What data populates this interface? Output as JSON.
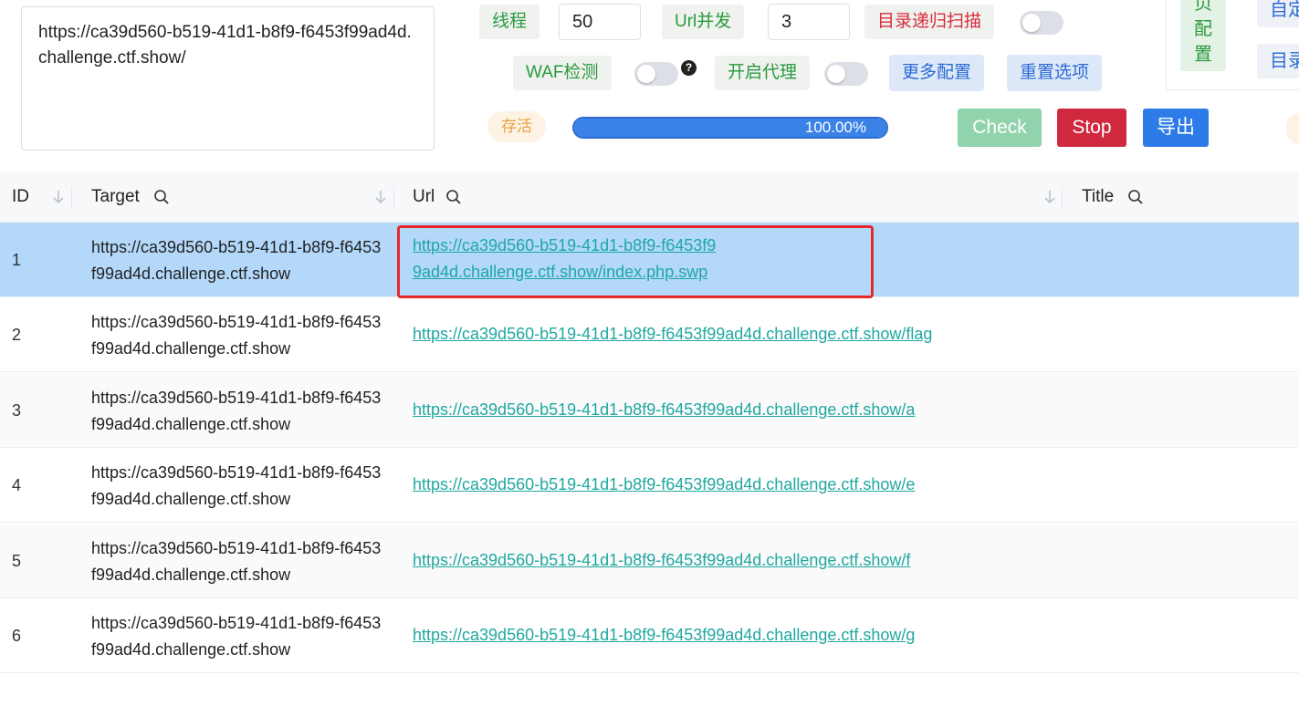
{
  "target_input": {
    "value": "https://ca39d560-b519-41d1-b8f9-f6453f99ad4d.challenge.ctf.show/"
  },
  "controls": {
    "threads_label": "线程",
    "threads_value": "50",
    "url_concurrency_label": "Url并发",
    "url_concurrency_value": "3",
    "recursive_scan_label": "目录递归扫描",
    "waf_detect_label": "WAF检测",
    "help_glyph": "?",
    "proxy_label": "开启代理",
    "more_config_label": "更多配置",
    "reset_options_label": "重置选项",
    "alive_label": "存活",
    "progress_text": "100.00%",
    "progress_value": 1.0,
    "check_label": "Check",
    "stop_label": "Stop",
    "export_label": "导出"
  },
  "right_panel": {
    "config_chars": [
      "页",
      "配",
      "置"
    ],
    "item1": "自定",
    "item2": "目录"
  },
  "colors": {
    "selected_row": "#b3d8fa",
    "link": "#1fa8a0",
    "highlight": "#e5282a",
    "stop": "#d0283e",
    "check": "#90d3ac",
    "export": "#2d7be8"
  },
  "table": {
    "headers": {
      "id": "ID",
      "target": "Target",
      "url": "Url",
      "title": "Title"
    },
    "rows": [
      {
        "id": "1",
        "target": "https://ca39d560-b519-41d1-b8f9-f6453f99ad4d.challenge.ctf.show",
        "url": "https://ca39d560-b519-41d1-b8f9-f6453f99ad4d.challenge.ctf.show/index.php.swp",
        "title": ""
      },
      {
        "id": "2",
        "target": "https://ca39d560-b519-41d1-b8f9-f6453f99ad4d.challenge.ctf.show",
        "url": "https://ca39d560-b519-41d1-b8f9-f6453f99ad4d.challenge.ctf.show/flag",
        "title": ""
      },
      {
        "id": "3",
        "target": "https://ca39d560-b519-41d1-b8f9-f6453f99ad4d.challenge.ctf.show",
        "url": "https://ca39d560-b519-41d1-b8f9-f6453f99ad4d.challenge.ctf.show/a",
        "title": ""
      },
      {
        "id": "4",
        "target": "https://ca39d560-b519-41d1-b8f9-f6453f99ad4d.challenge.ctf.show",
        "url": "https://ca39d560-b519-41d1-b8f9-f6453f99ad4d.challenge.ctf.show/e",
        "title": ""
      },
      {
        "id": "5",
        "target": "https://ca39d560-b519-41d1-b8f9-f6453f99ad4d.challenge.ctf.show",
        "url": "https://ca39d560-b519-41d1-b8f9-f6453f99ad4d.challenge.ctf.show/f",
        "title": ""
      },
      {
        "id": "6",
        "target": "https://ca39d560-b519-41d1-b8f9-f6453f99ad4d.challenge.ctf.show",
        "url": "https://ca39d560-b519-41d1-b8f9-f6453f99ad4d.challenge.ctf.show/g",
        "title": ""
      }
    ]
  }
}
